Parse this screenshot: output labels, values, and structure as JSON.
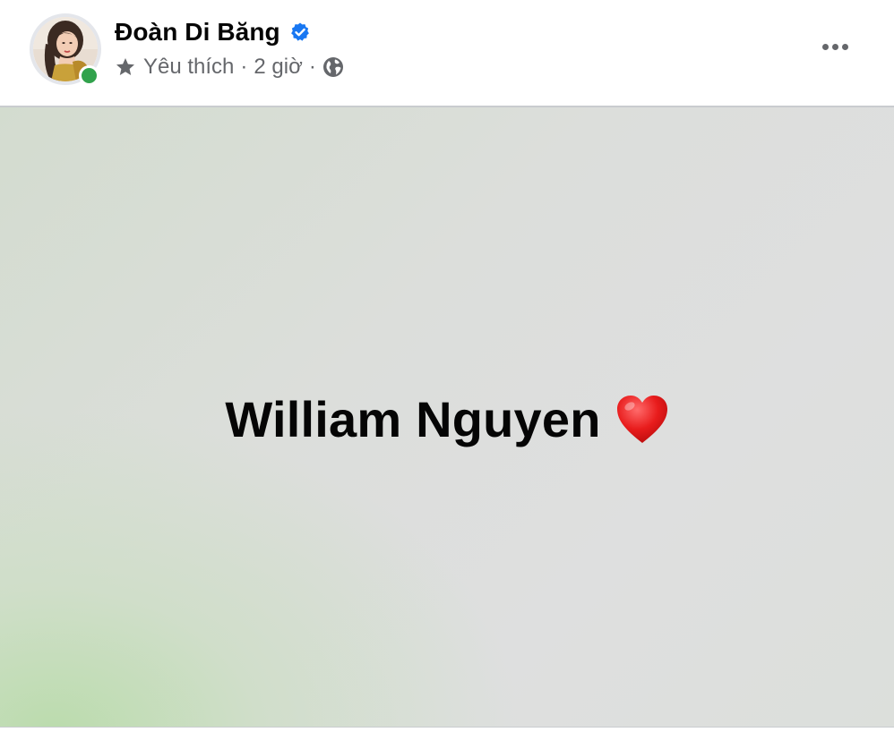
{
  "post": {
    "author_name": "Đoàn Di Băng",
    "verified": true,
    "audience_label": "Yêu thích",
    "separator": "·",
    "timestamp": "2 giờ",
    "privacy_icon": "globe-icon",
    "favorite_icon": "star-icon",
    "more_icon": "more-horizontal-icon",
    "online_status_color": "#31a24c",
    "verified_color": "#1877f2",
    "status_text": "William Nguyen",
    "status_emoji": "heart-icon"
  }
}
